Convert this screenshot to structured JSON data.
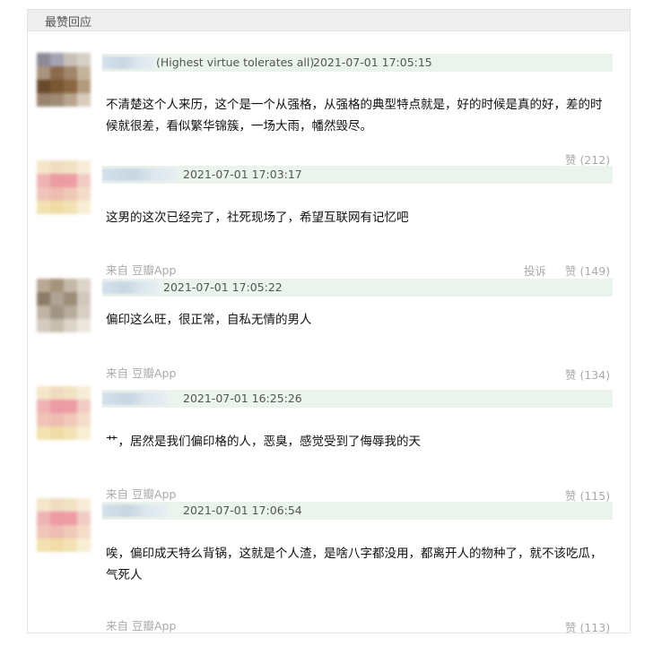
{
  "panel_title": "最赞回应",
  "comments": [
    {
      "name_note": "(Highest virtue tolerates all)",
      "time": "2021-07-01 17:05:15",
      "text": "不清楚这个人来历，这个是一个从强格，从强格的典型特点就是，好的时候是真的好，差的时候就很差，看似繁华锦簇，一场大雨，幡然毁尽。",
      "source": "",
      "report": "",
      "likes": "赞 (212)"
    },
    {
      "name_note": "",
      "time": "2021-07-01 17:03:17",
      "text": "这男的这次已经完了，社死现场了，希望互联网有记忆吧",
      "source": "来自 豆瓣App",
      "report": "投诉",
      "likes": "赞 (149)"
    },
    {
      "name_note": "",
      "time": "2021-07-01 17:05:22",
      "text": "偏印这么旺，很正常，自私无情的男人",
      "source": "来自 豆瓣App",
      "report": "",
      "likes": "赞 (134)"
    },
    {
      "name_note": "",
      "time": "2021-07-01 16:25:26",
      "text": "艹，居然是我们偏印格的人，恶臭，感觉受到了侮辱我的天",
      "source": "来自 豆瓣App",
      "report": "",
      "likes": "赞 (115)"
    },
    {
      "name_note": "",
      "time": "2021-07-01 17:06:54",
      "text": "唉，偏印成天特么背锅，这就是个人渣，是啥八字都没用，都离开人的物种了，就不该吃瓜，气死人",
      "source": "来自 豆瓣App",
      "report": "",
      "likes": "赞 (113)"
    }
  ]
}
